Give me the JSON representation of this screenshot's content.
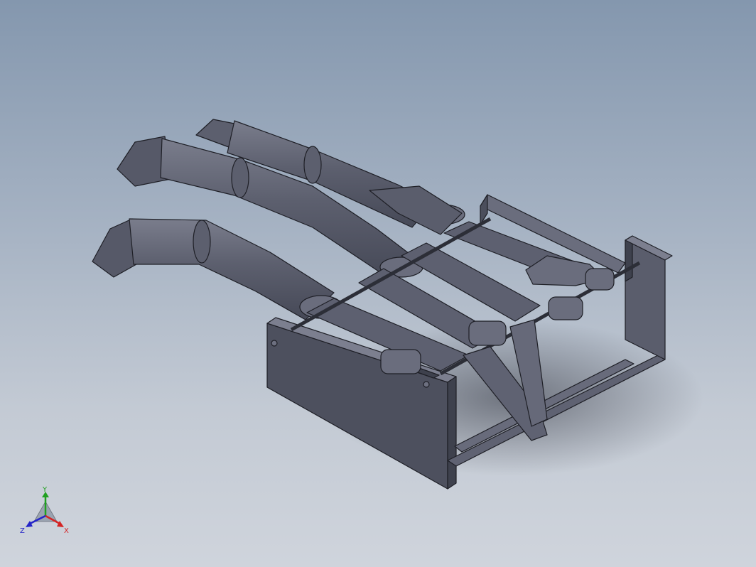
{
  "viewport": {
    "background_top": "#8497ae",
    "background_bottom": "#cfd4dc",
    "model_colors": {
      "face_dark": "#4b4e5c",
      "face_mid": "#5f6272",
      "face_light": "#7c7f8f",
      "edge": "#1e1f26"
    },
    "model_icon": "robotic-hand-assembly-icon"
  },
  "triad": {
    "x_label": "X",
    "y_label": "Y",
    "z_label": "Z",
    "x_color": "#d42424",
    "y_color": "#20a020",
    "z_color": "#2424c8"
  }
}
